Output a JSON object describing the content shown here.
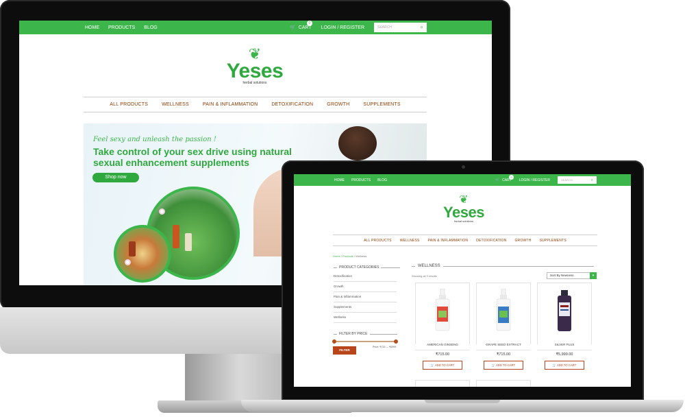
{
  "header": {
    "nav": [
      "HOME",
      "PRODUCTS",
      "BLOG"
    ],
    "cart_label": "CART",
    "cart_count": "0",
    "login_label": "LOGIN / REGISTER",
    "search_placeholder": "SEARCH"
  },
  "brand": {
    "name": "Yeses",
    "tagline": "herbal solutions"
  },
  "categories_nav": [
    "ALL PRODUCTS",
    "WELLNESS",
    "PAIN & INFLAMMATION",
    "DETOXIFICATION",
    "GROWTH",
    "SUPPLEMENTS"
  ],
  "banner": {
    "tagline": "Feel sexy and unleash the passion !",
    "headline": "Take control of your sex drive using natural sexual enhancement supplements",
    "cta": "Shop now"
  },
  "shop": {
    "breadcrumb": [
      "Home",
      "Products",
      "Wellness"
    ],
    "sidebar": {
      "categories_title": "PRODUCT CATEGORIES",
      "categories": [
        "Detoxification",
        "Growth",
        "Pain & Inflammation",
        "Supplements",
        "Wellness"
      ],
      "filter_title": "FILTER BY PRICE",
      "filter_button": "FILTER",
      "price_text": "Price: ₹715 — ₹5999"
    },
    "title": "WELLNESS",
    "showing": "Showing all 3 results",
    "sort": "Sort By Newness",
    "products": [
      {
        "name": "AMERICAN GINSENG",
        "price": "₹715.00",
        "button": "ADD TO CART"
      },
      {
        "name": "GRAPE SEED EXTRACT",
        "price": "₹715.00",
        "button": "ADD TO CART"
      },
      {
        "name": "SILVER PLUS",
        "price": "₹5,999.00",
        "button": "ADD TO CART"
      }
    ]
  },
  "colors": {
    "brand_green": "#3cb64a",
    "accent_brown": "#b8451a",
    "nav_brown": "#8a3a00"
  }
}
